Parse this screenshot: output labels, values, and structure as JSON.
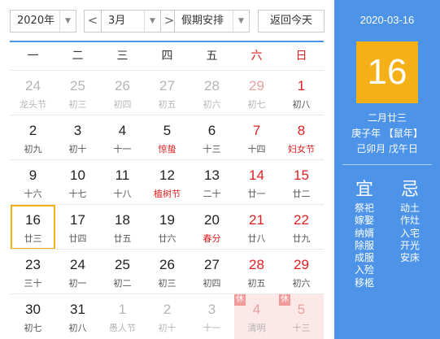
{
  "toolbar": {
    "year": "2020年",
    "prev": "<",
    "month": "3月",
    "next": ">",
    "holiday": "假期安排",
    "today_btn": "返回今天",
    "dropdown_glyph": "▼"
  },
  "weekdays": [
    "一",
    "二",
    "三",
    "四",
    "五",
    "六",
    "日"
  ],
  "weeks": [
    [
      {
        "num": "24",
        "lunar": "龙头节",
        "other": true
      },
      {
        "num": "25",
        "lunar": "初三",
        "other": true
      },
      {
        "num": "26",
        "lunar": "初四",
        "other": true
      },
      {
        "num": "27",
        "lunar": "初五",
        "other": true
      },
      {
        "num": "28",
        "lunar": "初六",
        "other": true
      },
      {
        "num": "29",
        "lunar": "初七",
        "other": true
      },
      {
        "num": "1",
        "lunar": "初八"
      }
    ],
    [
      {
        "num": "2",
        "lunar": "初九"
      },
      {
        "num": "3",
        "lunar": "初十"
      },
      {
        "num": "4",
        "lunar": "十一"
      },
      {
        "num": "5",
        "lunar": "惊蛰",
        "fest": true
      },
      {
        "num": "6",
        "lunar": "十三"
      },
      {
        "num": "7",
        "lunar": "十四"
      },
      {
        "num": "8",
        "lunar": "妇女节",
        "fest": true
      }
    ],
    [
      {
        "num": "9",
        "lunar": "十六"
      },
      {
        "num": "10",
        "lunar": "十七"
      },
      {
        "num": "11",
        "lunar": "十八"
      },
      {
        "num": "12",
        "lunar": "植树节",
        "fest": true
      },
      {
        "num": "13",
        "lunar": "二十"
      },
      {
        "num": "14",
        "lunar": "廿一"
      },
      {
        "num": "15",
        "lunar": "廿二"
      }
    ],
    [
      {
        "num": "16",
        "lunar": "廿三",
        "today": true
      },
      {
        "num": "17",
        "lunar": "廿四"
      },
      {
        "num": "18",
        "lunar": "廿五"
      },
      {
        "num": "19",
        "lunar": "廿六"
      },
      {
        "num": "20",
        "lunar": "春分",
        "fest": true
      },
      {
        "num": "21",
        "lunar": "廿八"
      },
      {
        "num": "22",
        "lunar": "廿九"
      }
    ],
    [
      {
        "num": "23",
        "lunar": "三十"
      },
      {
        "num": "24",
        "lunar": "初一"
      },
      {
        "num": "25",
        "lunar": "初二"
      },
      {
        "num": "26",
        "lunar": "初三"
      },
      {
        "num": "27",
        "lunar": "初四"
      },
      {
        "num": "28",
        "lunar": "初五"
      },
      {
        "num": "29",
        "lunar": "初六"
      }
    ],
    [
      {
        "num": "30",
        "lunar": "初七"
      },
      {
        "num": "31",
        "lunar": "初八"
      },
      {
        "num": "1",
        "lunar": "愚人节",
        "other": true
      },
      {
        "num": "2",
        "lunar": "初十",
        "other": true
      },
      {
        "num": "3",
        "lunar": "十一",
        "other": true
      },
      {
        "num": "4",
        "lunar": "清明",
        "other": true,
        "rest": true,
        "badge": "休"
      },
      {
        "num": "5",
        "lunar": "十三",
        "other": true,
        "rest": true,
        "badge": "休"
      }
    ]
  ],
  "detail": {
    "date": "2020-03-16",
    "day": "16",
    "lunar_date": "二月廿三",
    "year_ganzhi": "庚子年 【鼠年】",
    "month_day_ganzhi": "己卯月 戊午日",
    "yi_title": "宜",
    "ji_title": "忌",
    "yi": [
      "祭祀",
      "嫁娶",
      "纳婿",
      "除服",
      "成服",
      "入殓",
      "移柩"
    ],
    "ji": [
      "动土",
      "作灶",
      "入宅",
      "开光",
      "安床"
    ]
  },
  "colors": {
    "accent": "#4d94e8",
    "today_highlight": "#f5b018",
    "weekend_red": "#e02020",
    "rest_bg": "#fde8e8"
  }
}
